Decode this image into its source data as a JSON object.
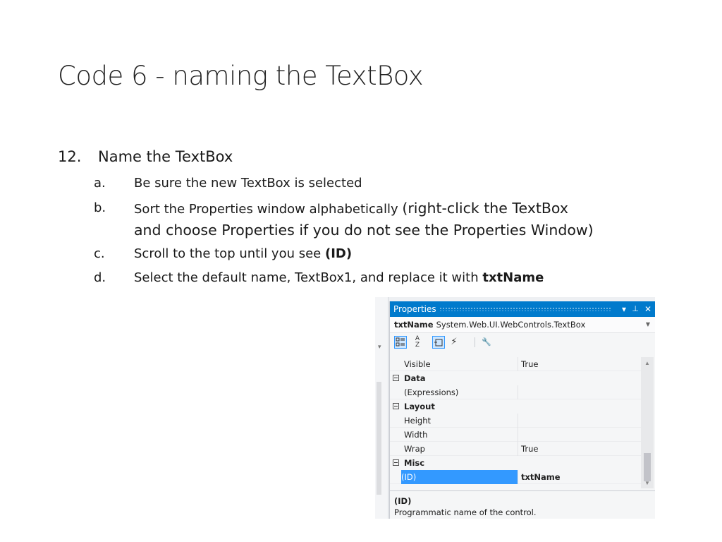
{
  "slide": {
    "title": "Code 6 - naming the TextBox",
    "step_number": "12.",
    "step_text": "Name the TextBox",
    "substeps": [
      {
        "letter": "a.",
        "text": "Be sure the new TextBox is selected"
      },
      {
        "letter": "b.",
        "text": "Sort the Properties window alphabetically",
        "text_large": "(right-click the TextBox",
        "line2": "and choose Properties if you do not see the Properties Window)"
      },
      {
        "letter": "c.",
        "text": "Scroll to the top until you see",
        "bold": "(ID)"
      },
      {
        "letter": "d.",
        "text": "Select the default name, TextBox1, and replace it with",
        "bold": "txtName"
      }
    ]
  },
  "properties_window": {
    "title": "Properties",
    "title_controls": {
      "dropdown": "▾",
      "pin": "ᵖ",
      "close": "✕"
    },
    "object_name": "txtName",
    "object_type": "System.Web.UI.WebControls.TextBox",
    "toolbar": [
      "categorized-icon",
      "alphabetical-icon",
      "properties-icon",
      "events-icon",
      "property-pages-icon"
    ],
    "rows": [
      {
        "kind": "prop",
        "name": "Visible",
        "value": "True"
      },
      {
        "kind": "cat",
        "name": "Data"
      },
      {
        "kind": "prop",
        "name": "(Expressions)",
        "value": ""
      },
      {
        "kind": "cat",
        "name": "Layout"
      },
      {
        "kind": "prop",
        "name": "Height",
        "value": ""
      },
      {
        "kind": "prop",
        "name": "Width",
        "value": ""
      },
      {
        "kind": "prop",
        "name": "Wrap",
        "value": "True"
      },
      {
        "kind": "cat",
        "name": "Misc"
      },
      {
        "kind": "prop",
        "name": "(ID)",
        "value": "txtName",
        "selected": true
      }
    ],
    "description_title": "(ID)",
    "description_text": "Programmatic name of the control."
  },
  "colors": {
    "title_bar": "#007acc",
    "selection": "#3399ff"
  }
}
